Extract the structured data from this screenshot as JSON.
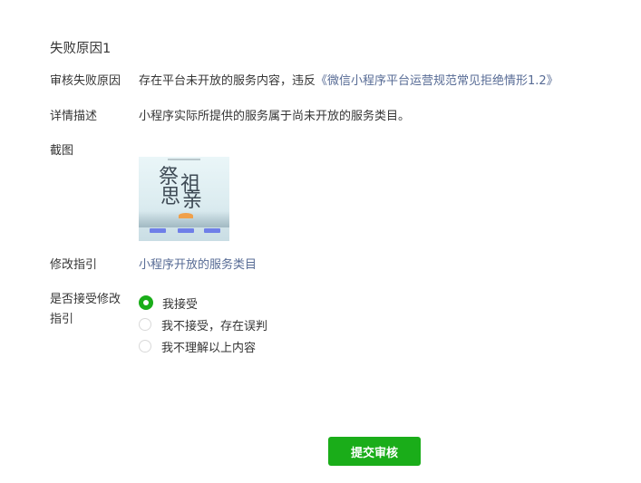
{
  "section_title": "失败原因1",
  "reason": {
    "label": "审核失败原因",
    "text": "存在平台未开放的服务内容，违反",
    "link": "《微信小程序平台运营规范常见拒绝情形1.2》"
  },
  "detail": {
    "label": "详情描述",
    "text": "小程序实际所提供的服务属于尚未开放的服务类目。"
  },
  "screenshot": {
    "label": "截图",
    "image_text": [
      "祭",
      "祖",
      "思",
      "亲"
    ]
  },
  "guide": {
    "label": "修改指引",
    "link": "小程序开放的服务类目"
  },
  "accept": {
    "label": "是否接受修改指引",
    "options": [
      {
        "label": "我接受",
        "checked": true
      },
      {
        "label": "我不接受，存在误判",
        "checked": false
      },
      {
        "label": "我不理解以上内容",
        "checked": false
      }
    ]
  },
  "submit_label": "提交审核",
  "colors": {
    "primary_green": "#1aad19",
    "link_blue": "#576b95",
    "text": "#353535"
  }
}
